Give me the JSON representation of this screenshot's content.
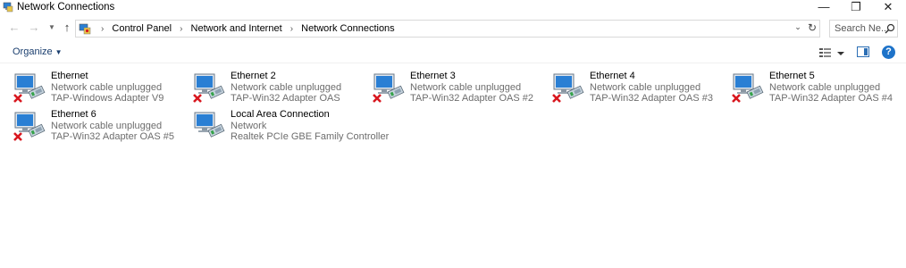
{
  "window": {
    "title": "Network Connections",
    "controls": {
      "minimize": "—",
      "maximize": "❐",
      "close": "✕"
    }
  },
  "navigation": {
    "back": "←",
    "forward": "→",
    "up": "↑",
    "breadcrumbs": [
      "Control Panel",
      "Network and Internet",
      "Network Connections"
    ]
  },
  "search": {
    "placeholder": "Search Ne..."
  },
  "toolbar": {
    "organize_label": "Organize"
  },
  "connections": [
    {
      "name": "Ethernet",
      "status": "Network cable unplugged",
      "adapter": "TAP-Windows Adapter V9",
      "disconnected": true
    },
    {
      "name": "Ethernet 2",
      "status": "Network cable unplugged",
      "adapter": "TAP-Win32 Adapter OAS",
      "disconnected": true
    },
    {
      "name": "Ethernet 3",
      "status": "Network cable unplugged",
      "adapter": "TAP-Win32 Adapter OAS #2",
      "disconnected": true
    },
    {
      "name": "Ethernet 4",
      "status": "Network cable unplugged",
      "adapter": "TAP-Win32 Adapter OAS #3",
      "disconnected": true
    },
    {
      "name": "Ethernet 5",
      "status": "Network cable unplugged",
      "adapter": "TAP-Win32 Adapter OAS #4",
      "disconnected": true
    },
    {
      "name": "Ethernet 6",
      "status": "Network cable unplugged",
      "adapter": "TAP-Win32 Adapter OAS #5",
      "disconnected": true
    },
    {
      "name": "Local Area Connection",
      "status": "Network",
      "adapter": "Realtek PCIe GBE Family Controller",
      "disconnected": false
    }
  ],
  "colors": {
    "link_text": "#1a3e6e",
    "secondary_text": "#6d6d6d",
    "monitor_blue": "#2a7fd4",
    "error_red": "#d8171f",
    "help_blue": "#1e73c9"
  },
  "icons": {
    "app": "network-connections-icon",
    "connection": "network-adapter-icon",
    "disconnected_overlay": "red-x-icon",
    "search": "search-icon",
    "refresh": "refresh-icon",
    "help": "help-icon"
  }
}
